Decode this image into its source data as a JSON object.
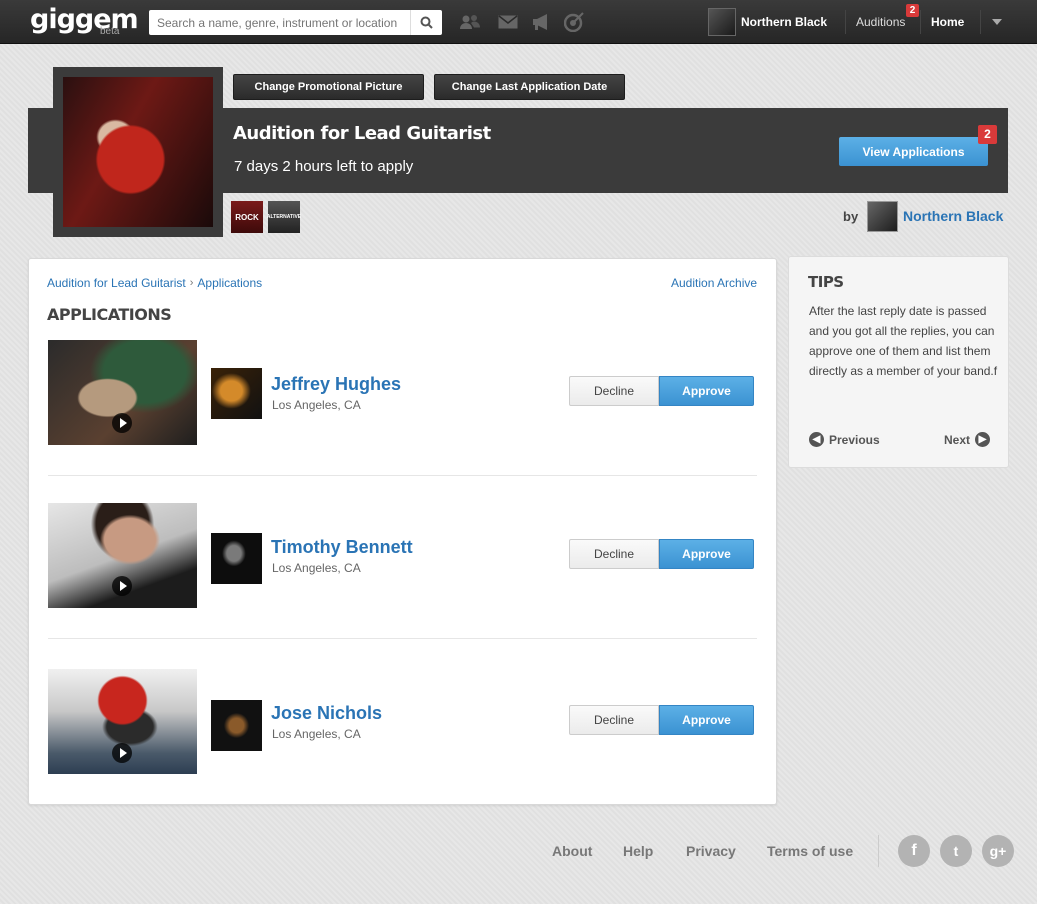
{
  "topbar": {
    "logo": "giggem",
    "logo_beta": "beta",
    "search_placeholder": "Search a name, genre, instrument or location",
    "user_name": "Northern Black",
    "auditions_label": "Auditions",
    "auditions_badge": "2",
    "home_label": "Home"
  },
  "header": {
    "change_picture_label": "Change Promotional Picture",
    "change_date_label": "Change Last Application Date",
    "title": "Audition for Lead Guitarist",
    "time_left": "7 days 2 hours left to apply",
    "view_applications_label": "View Applications",
    "view_applications_badge": "2",
    "tags": [
      "ROCK",
      "ALTERNATIVE"
    ],
    "by_label": "by",
    "by_name": "Northern Black"
  },
  "main": {
    "breadcrumb": [
      "Audition for Lead Guitarist",
      "Applications"
    ],
    "archive_link": "Audition Archive",
    "section_title": "APPLICATIONS",
    "applications": [
      {
        "name": "Jeffrey Hughes",
        "location": "Los Angeles, CA",
        "decline_label": "Decline",
        "approve_label": "Approve"
      },
      {
        "name": "Timothy Bennett",
        "location": "Los Angeles, CA",
        "decline_label": "Decline",
        "approve_label": "Approve"
      },
      {
        "name": "Jose Nichols",
        "location": "Los Angeles, CA",
        "decline_label": "Decline",
        "approve_label": "Approve"
      }
    ]
  },
  "tips": {
    "title": "TIPS",
    "body": "After the last reply date is passed and you got all the replies, you can approve one of them and list them directly as a member of your band.f",
    "previous_label": "Previous",
    "next_label": "Next"
  },
  "footer": {
    "links": [
      "About",
      "Help",
      "Privacy",
      "Terms of use"
    ],
    "social": [
      "f",
      "t",
      "g+"
    ]
  },
  "colors": {
    "accent": "#3b92d2",
    "link": "#2a74b5",
    "badge": "#d93a3a",
    "dark_band": "#3b3b3b"
  }
}
